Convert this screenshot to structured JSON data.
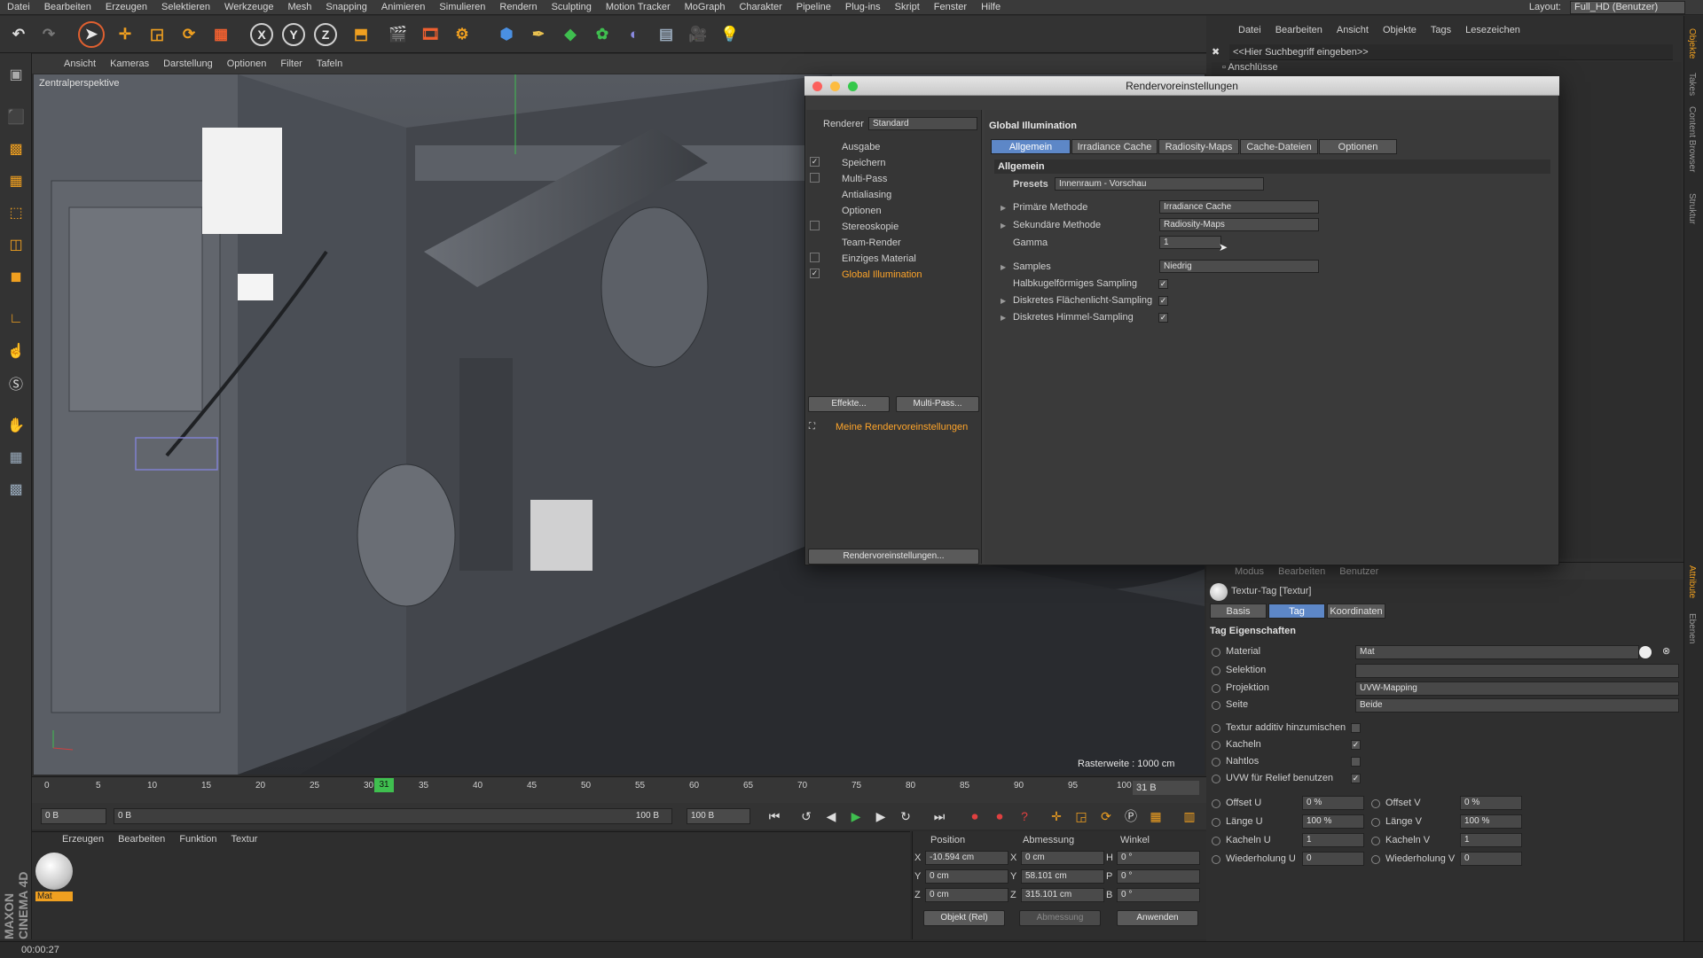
{
  "menubar": {
    "items": [
      "Datei",
      "Bearbeiten",
      "Erzeugen",
      "Selektieren",
      "Werkzeuge",
      "Mesh",
      "Snapping",
      "Animieren",
      "Simulieren",
      "Rendern",
      "Sculpting",
      "Motion Tracker",
      "MoGraph",
      "Charakter",
      "Pipeline",
      "Plug-ins",
      "Skript",
      "Fenster",
      "Hilfe"
    ],
    "layout_label": "Layout:",
    "layout_value": "Full_HD (Benutzer)"
  },
  "viewport": {
    "menu": [
      "Ansicht",
      "Kameras",
      "Darstellung",
      "Optionen",
      "Filter",
      "Tafeln"
    ],
    "label": "Zentralperspektive",
    "raster": "Rasterweite : 1000 cm"
  },
  "timeline": {
    "ticks": [
      "0",
      "5",
      "10",
      "15",
      "20",
      "25",
      "30",
      "35",
      "40",
      "45",
      "50",
      "55",
      "60",
      "65",
      "70",
      "75",
      "80",
      "85",
      "90",
      "95",
      "100"
    ],
    "current": "31",
    "frame_field": "31 B",
    "start": "0 B",
    "slider_start": "0 B",
    "slider_end": "100 B",
    "end": "100 B"
  },
  "material_manager": {
    "menu": [
      "Erzeugen",
      "Bearbeiten",
      "Funktion",
      "Textur"
    ],
    "material_name": "Mat"
  },
  "coordinates": {
    "headers": [
      "Position",
      "Abmessung",
      "Winkel"
    ],
    "pos": {
      "x": "-10.594 cm",
      "y": "0 cm",
      "z": "0 cm"
    },
    "size": {
      "x": "0 cm",
      "y": "58.101 cm",
      "z": "315.101 cm"
    },
    "rot": {
      "h": "0 °",
      "p": "0 °",
      "b": "0 °"
    },
    "axis_labels": {
      "x": "X",
      "y": "Y",
      "z": "Z",
      "h": "H",
      "p": "P",
      "b": "B"
    },
    "mode": "Objekt (Rel)",
    "size_mode": "Abmessung",
    "apply": "Anwenden"
  },
  "status": {
    "time": "00:00:27"
  },
  "logo": "MAXON CINEMA 4D",
  "object_manager": {
    "menu": [
      "Datei",
      "Bearbeiten",
      "Ansicht",
      "Objekte",
      "Tags",
      "Lesezeichen"
    ],
    "search_placeholder": "<<Hier Suchbegriff eingeben>>",
    "row": "Anschlüsse"
  },
  "attribute_manager": {
    "menu": [
      "Modus",
      "Bearbeiten",
      "Benutzer"
    ],
    "title": "Textur-Tag [Textur]",
    "tabs": [
      "Basis",
      "Tag",
      "Koordinaten"
    ],
    "section": "Tag Eigenschaften",
    "material_label": "Material",
    "material_value": "Mat",
    "selection_label": "Selektion",
    "selection_value": "",
    "projection_label": "Projektion",
    "projection_value": "UVW-Mapping",
    "side_label": "Seite",
    "side_value": "Beide",
    "additive_label": "Textur additiv hinzumischen",
    "tile_label": "Kacheln",
    "seamless_label": "Nahtlos",
    "uvw_relief_label": "UVW für Relief benutzen",
    "offset_u_label": "Offset U",
    "offset_u": "0 %",
    "offset_v_label": "Offset V",
    "offset_v": "0 %",
    "length_u_label": "Länge U",
    "length_u": "100 %",
    "length_v_label": "Länge V",
    "length_v": "100 %",
    "tiles_u_label": "Kacheln U",
    "tiles_u": "1",
    "tiles_v_label": "Kacheln V",
    "tiles_v": "1",
    "repeat_u_label": "Wiederholung U",
    "repeat_u": "0",
    "repeat_v_label": "Wiederholung V",
    "repeat_v": "0"
  },
  "side_tabs": [
    "Objekte",
    "Takes",
    "Content Browser",
    "Struktur",
    "Attribute",
    "Ebenen"
  ],
  "dialog": {
    "title": "Rendervoreinstellungen",
    "renderer_label": "Renderer",
    "renderer_value": "Standard",
    "nav": [
      "Ausgabe",
      "Speichern",
      "Multi-Pass",
      "Antialiasing",
      "Optionen",
      "Stereoskopie",
      "Team-Render",
      "Einziges Material",
      "Global Illumination"
    ],
    "effects_button": "Effekte...",
    "multipass_button": "Multi-Pass...",
    "preset_name": "Meine Rendervoreinstellungen",
    "bottom_button": "Rendervoreinstellungen...",
    "section_title": "Global Illumination",
    "tabs": [
      "Allgemein",
      "Irradiance Cache",
      "Radiosity-Maps",
      "Cache-Dateien",
      "Optionen"
    ],
    "group": "Allgemein",
    "presets_label": "Presets",
    "presets_value": "Innenraum - Vorschau",
    "primary_label": "Primäre Methode",
    "primary_value": "Irradiance Cache",
    "secondary_label": "Sekundäre Methode",
    "secondary_value": "Radiosity-Maps",
    "gamma_label": "Gamma",
    "gamma_value": "1",
    "samples_label": "Samples",
    "samples_value": "Niedrig",
    "hemi_label": "Halbkugelförmiges Sampling",
    "area_label": "Diskretes Flächenlicht-Sampling",
    "sky_label": "Diskretes Himmel-Sampling"
  }
}
